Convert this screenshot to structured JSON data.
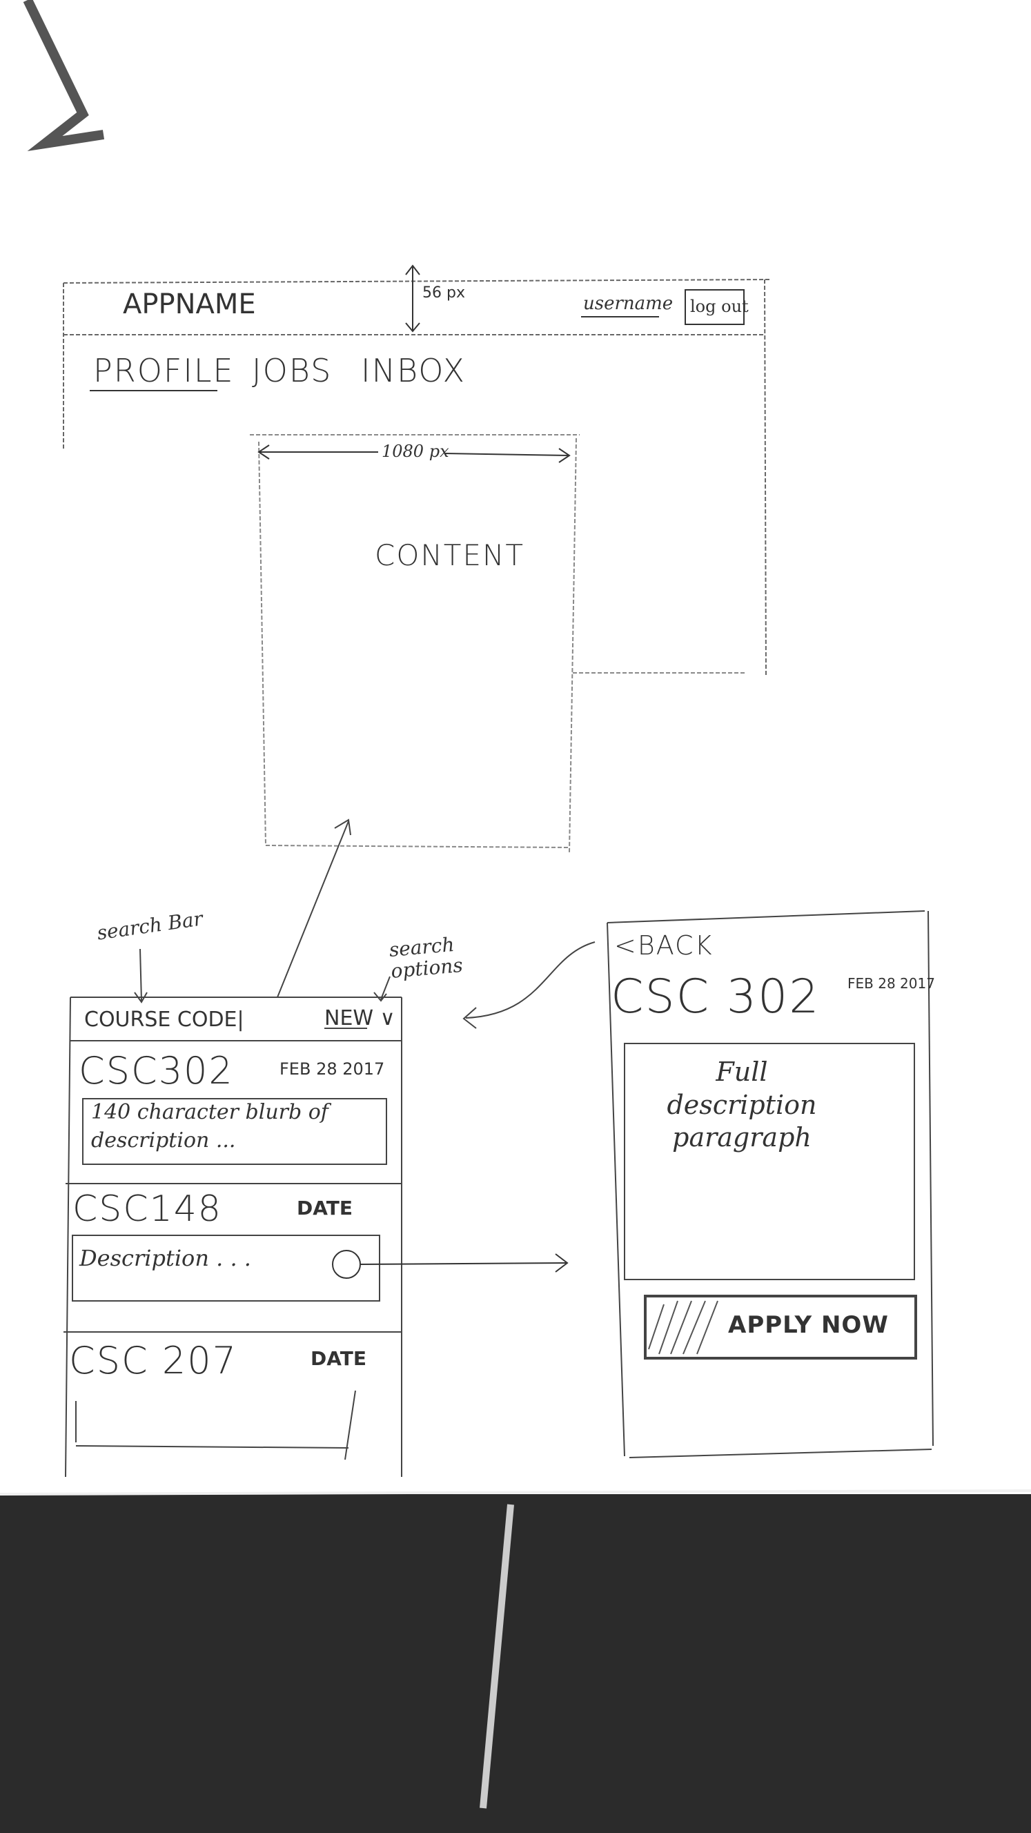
{
  "desktop": {
    "app_name": "APPNAME",
    "height_note": "56 px",
    "username": "username",
    "logout_label": "log out",
    "nav_tabs": [
      {
        "label": "PROFILE"
      },
      {
        "label": "JOBS"
      },
      {
        "label": "INBOX"
      }
    ],
    "width_note": "1080 px",
    "content_label": "CONTENT"
  },
  "annotations": {
    "search_bar": "search Bar",
    "search_options": "search options"
  },
  "list_screen": {
    "search_placeholder": "COURSE CODE|",
    "sort_option": "NEW",
    "items": [
      {
        "code": "CSC302",
        "date": "FEB 28 2017",
        "description": "140 character blurb of description ..."
      },
      {
        "code": "CSC148",
        "date": "DATE",
        "description": "Description . . ."
      },
      {
        "code": "CSC 207",
        "date": "DATE",
        "description": ""
      }
    ]
  },
  "detail_screen": {
    "back_label": "<BACK",
    "code": "CSC 302",
    "date": "FEB 28 2017",
    "description": "Full description paragraph",
    "apply_label": "APPLY NOW"
  },
  "colors": {
    "ink": "#2a2a2a",
    "dashed_line": "#888888",
    "background_photo": "#2b2b2b"
  }
}
